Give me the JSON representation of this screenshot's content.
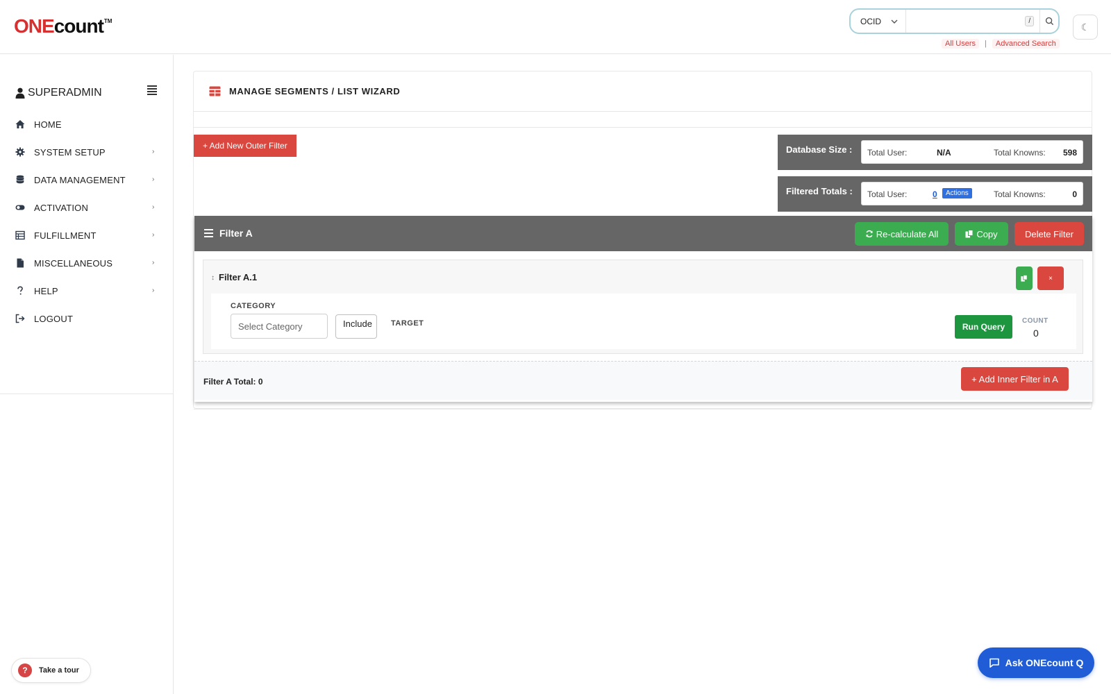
{
  "brand": {
    "logo_one": "ONE",
    "logo_count": "count",
    "logo_tm": "TM",
    "accent": "#d63031"
  },
  "search": {
    "type_value": "OCID",
    "placeholder": "",
    "shortcut": "/",
    "links": [
      "All Users",
      "Advanced Search"
    ],
    "separator": "|"
  },
  "theme_toggle": {
    "icon": "moon-icon",
    "glyph": "☾"
  },
  "sidebar": {
    "user": "SUPERADMIN",
    "items": [
      {
        "label": "HOME",
        "icon": "home-icon",
        "chevron": ""
      },
      {
        "label": "SYSTEM SETUP",
        "icon": "gear-icon",
        "chevron": "›"
      },
      {
        "label": "DATA MANAGEMENT",
        "icon": "database-icon",
        "chevron": "›"
      },
      {
        "label": "ACTIVATION",
        "icon": "toggle-icon",
        "chevron": "›"
      },
      {
        "label": "FULFILLMENT",
        "icon": "fulfillment-icon",
        "chevron": "›"
      },
      {
        "label": "MISCELLANEOUS",
        "icon": "file-icon",
        "chevron": "›"
      },
      {
        "label": "HELP",
        "icon": "question-icon",
        "chevron": "›"
      },
      {
        "label": "LOGOUT",
        "icon": "logout-icon",
        "chevron": ""
      }
    ],
    "tour_label": "Take a tour",
    "tour_glyph": "?"
  },
  "main": {
    "title": "MANAGE SEGMENTS / LIST WIZARD",
    "add_outer_label": "+ Add New Outer Filter",
    "database_size": {
      "label": "Database Size :",
      "total_user_label": "Total User:",
      "total_user_value": "N/A",
      "total_knowns_label": "Total Knowns:",
      "total_knowns_value": "598"
    },
    "filtered_totals": {
      "label": "Filtered Totals :",
      "total_user_label": "Total User:",
      "total_user_value": "0",
      "actions_label": "Actions",
      "total_knowns_label": "Total Knowns:",
      "total_knowns_value": "0"
    },
    "filter_a": {
      "title": "Filter A",
      "recalc_label": "Re-calculate All",
      "copy_label": "Copy",
      "delete_label": "Delete Filter",
      "inner": {
        "drag_glyph": "↕",
        "title": "Filter A.1",
        "close_glyph": "×",
        "category_label": "CATEGORY",
        "category_placeholder": "Select Category",
        "include_label": "Include",
        "target_label": "TARGET",
        "run_query_label": "Run Query",
        "count_label": "COUNT",
        "count_value": "0"
      },
      "total_label": "Filter A Total: 0",
      "add_inner_label": "+ Add Inner Filter in A"
    }
  },
  "ask": {
    "label": "Ask ONEcount Q"
  },
  "colors": {
    "red": "#d9473f",
    "green": "#3bac4f",
    "dark_green": "#1e9640",
    "gray_bar": "#666666",
    "blue": "#1f5cd6"
  }
}
